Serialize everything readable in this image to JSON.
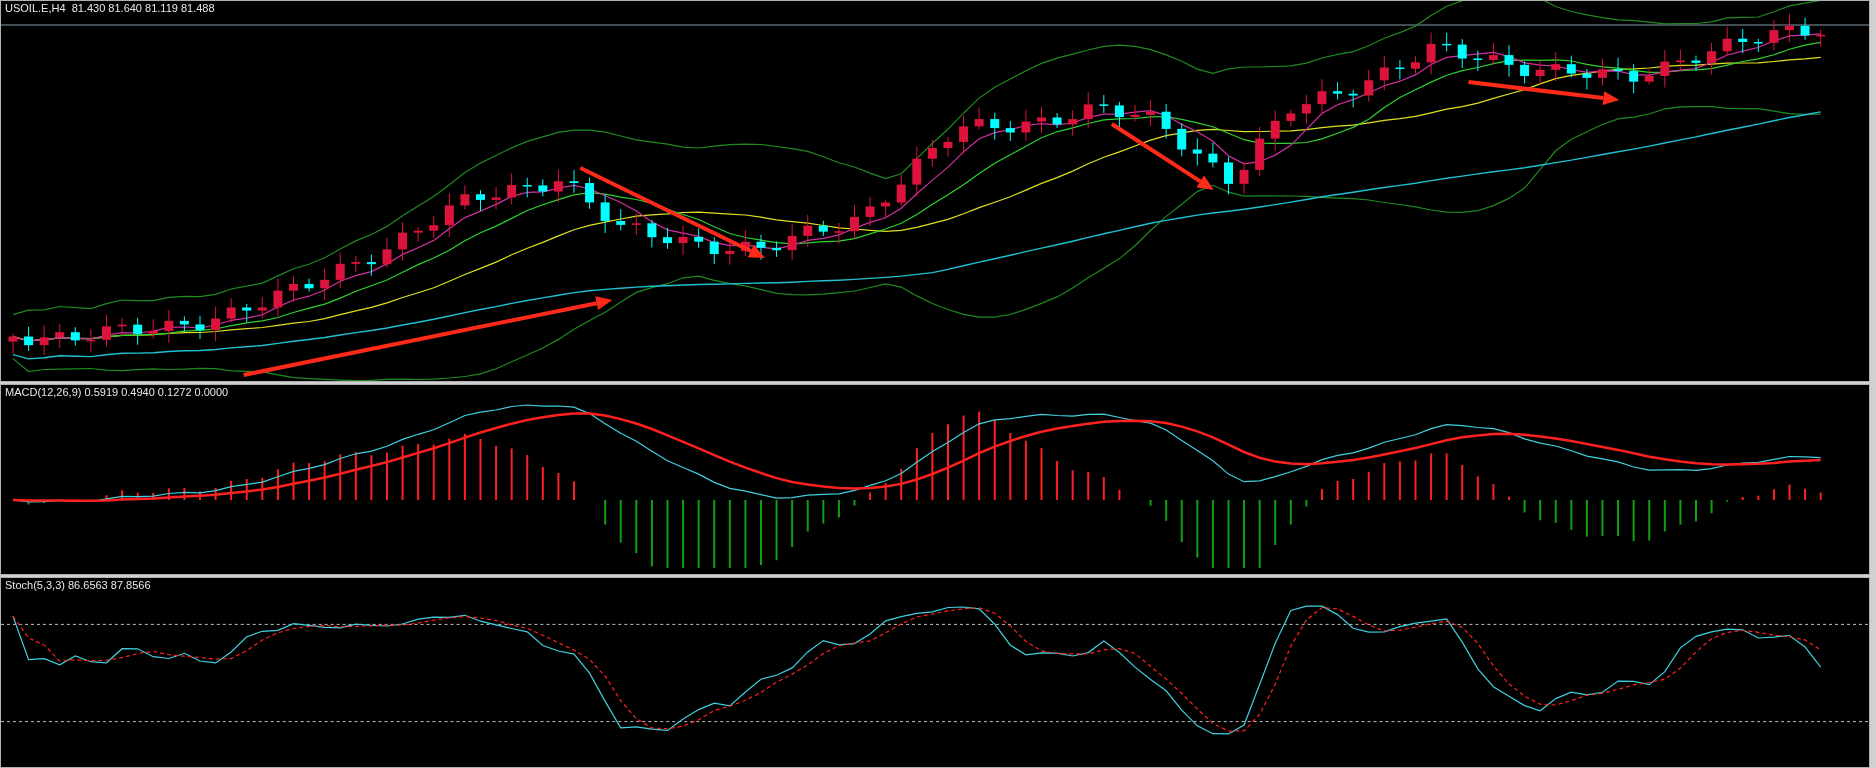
{
  "panels": [
    {
      "kind": "price",
      "label": "USOIL.E,H4  81.430 81.640 81.119 81.488"
    },
    {
      "kind": "macd",
      "label": "MACD(12,26,9) 0.5919 0.4940 0.1272 0.0000"
    },
    {
      "kind": "stochastic",
      "label": "Stoch(5,3,3) 86.6563 87.8566"
    }
  ]
}
